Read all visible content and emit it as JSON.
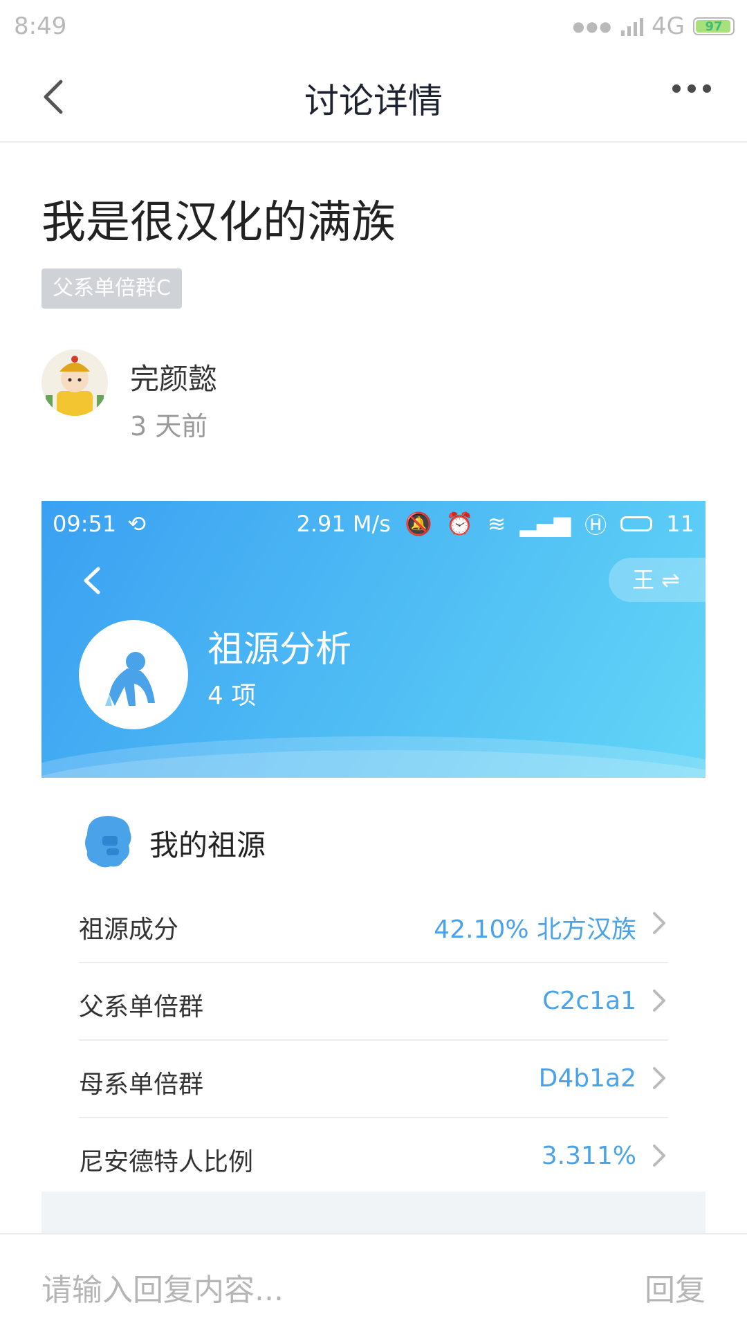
{
  "status_bar": {
    "time": "8:49",
    "network": "4G",
    "battery": "97"
  },
  "nav": {
    "title": "讨论详情"
  },
  "post": {
    "title": "我是很汉化的满族",
    "tag": "父系单倍群C",
    "author": "完颜懿",
    "time": "3 天前"
  },
  "screenshot": {
    "status": {
      "time": "09:51",
      "speed": "2.91 M/s",
      "battery": "11"
    },
    "switch_label": "王 ⇌",
    "title": "祖源分析",
    "subtitle": "4 项",
    "section_title": "我的祖源",
    "rows": [
      {
        "label": "祖源成分",
        "value": "42.10% 北方汉族"
      },
      {
        "label": "父系单倍群",
        "value": "C2c1a1"
      },
      {
        "label": "母系单倍群",
        "value": "D4b1a2"
      },
      {
        "label": "尼安德特人比例",
        "value": "3.311%"
      }
    ]
  },
  "bottom": {
    "placeholder": "请输入回复内容...",
    "reply": "回复"
  },
  "colors": {
    "accent": "#4aa3e8",
    "hero_start": "#3aa0f2",
    "hero_end": "#63d6f7"
  }
}
